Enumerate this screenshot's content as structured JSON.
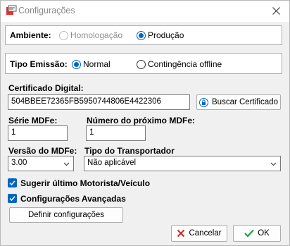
{
  "window": {
    "title": "Configurações",
    "close_icon": "close-icon"
  },
  "ambiente": {
    "label": "Ambiente:",
    "options": [
      "Homologação",
      "Produção"
    ],
    "selected": "Produção"
  },
  "tipo_emissao": {
    "label": "Tipo Emissão:",
    "options": [
      "Normal",
      "Contingência offline"
    ],
    "selected": "Normal"
  },
  "certificado": {
    "label": "Certificado Digital:",
    "value": "504BBEE72365FB5950744806E4422306",
    "button": "Buscar Certificado"
  },
  "serie": {
    "label": "Série MDFe:",
    "value": "1"
  },
  "proximo": {
    "label": "Número do próximo MDFe:",
    "value": "1"
  },
  "versao": {
    "label": "Versão do MDFe:",
    "value": "3.00"
  },
  "transportador": {
    "label": "Tipo do Transportador",
    "value": "Não aplicável"
  },
  "checkboxes": {
    "sugerir": {
      "label": "Sugerir último Motorista/Veículo",
      "checked": true
    },
    "avancadas": {
      "label": "Configurações Avançadas",
      "checked": true
    }
  },
  "definir_button": "Definir configurações",
  "cancel_button": "Cancelar",
  "ok_button": "OK",
  "colors": {
    "accent": "#0067c0",
    "cancel": "#d32020",
    "ok": "#1e9e3a"
  }
}
